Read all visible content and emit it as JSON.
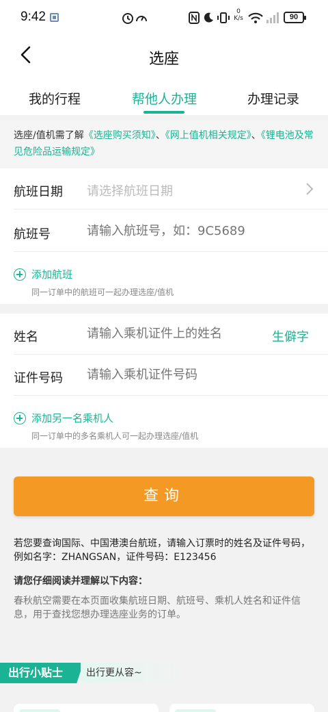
{
  "status": {
    "time": "9:42",
    "speed_value": "0",
    "speed_unit": "K/s",
    "battery": "90"
  },
  "nav": {
    "title": "选座"
  },
  "tabs": [
    {
      "label": "我的行程"
    },
    {
      "label": "帮他人办理",
      "active": true
    },
    {
      "label": "办理记录"
    }
  ],
  "notice": {
    "prefix": "选座/值机需了解",
    "link1": "《选座购买须知》",
    "sep1": "、",
    "link2": "《网上值机相关规定》",
    "sep2": "、",
    "link3": "《锂电池及常见危险品运输规定》"
  },
  "flight": {
    "date_label": "航班日期",
    "date_placeholder": "请选择航班日期",
    "number_label": "航班号",
    "number_placeholder": "请输入航班号，如：9C5689",
    "add_label": "添加航班",
    "add_hint": "同一订单中的航班可一起办理选座/值机"
  },
  "passenger": {
    "name_label": "姓名",
    "name_placeholder": "请输入乘机证件上的姓名",
    "rare_char": "生僻字",
    "id_label": "证件号码",
    "id_placeholder": "请输入乘机证件号码",
    "add_label": "添加另一名乘机人",
    "add_hint": "同一订单中的多名乘机人可一起办理选座/值机"
  },
  "query_button": "查询",
  "info": {
    "intl_note": "若您要查询国际、中国港澳台航班，请输入订票时的姓名及证件号码，例如名字：ZHANGSAN，证件号码：E123456",
    "read_head": "请您仔细阅读并理解以下内容：",
    "privacy": "春秋航空需要在本页面收集航班日期、航班号、乘机人姓名和证件信息，用于查找您想办理选座业务的订单。"
  },
  "tips": {
    "tag": "出行小贴士",
    "sub": "出行更从容~"
  },
  "colors": {
    "accent": "#1ab394",
    "button": "#f49a24"
  }
}
